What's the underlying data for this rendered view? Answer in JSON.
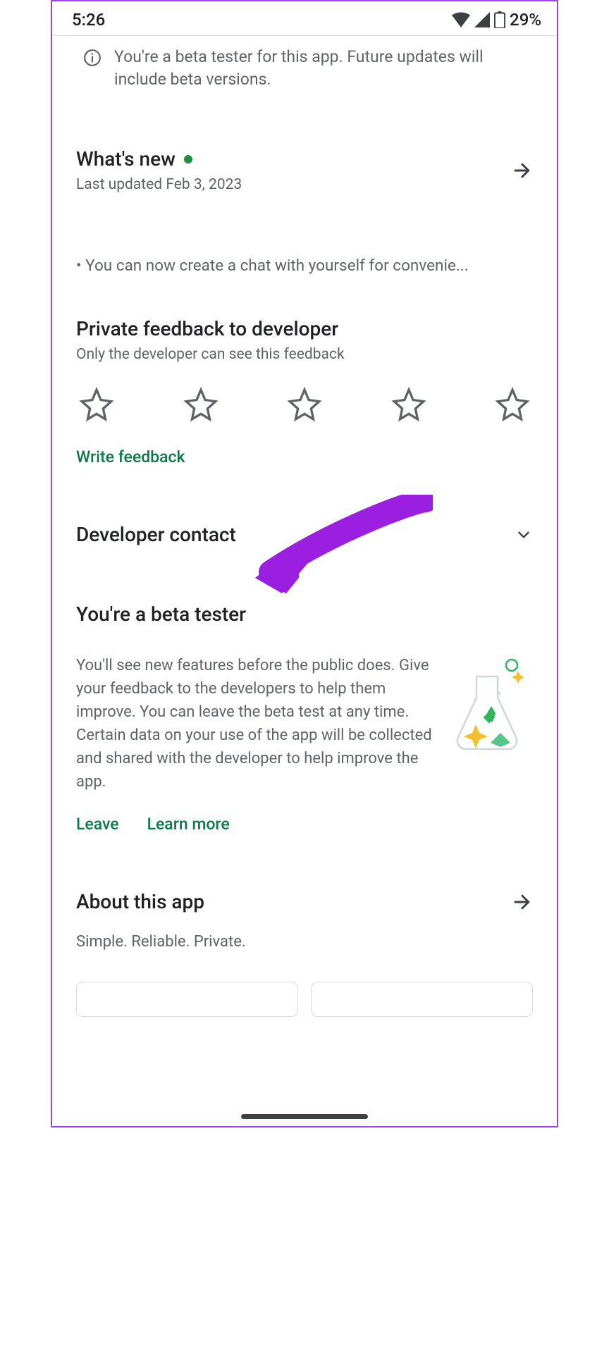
{
  "status": {
    "time": "5:26",
    "battery_pct": "29%"
  },
  "banner": {
    "text": "You're a beta tester for this app. Future updates will include beta versions."
  },
  "whats_new": {
    "title": "What's new",
    "updated": "Last updated Feb 3, 2023",
    "changelog": "• You can now create a chat with yourself for convenie..."
  },
  "feedback": {
    "title": "Private feedback to developer",
    "sub": "Only the developer can see this feedback",
    "write": "Write feedback"
  },
  "dev_contact": {
    "title": "Developer contact"
  },
  "beta": {
    "title": "You're a beta tester",
    "body": "You'll see new features before the public does. Give your feedback to the developers to help them improve. You can leave the beta test at any time. Certain data on your use of the app will be collected and shared with the developer to help improve the app.",
    "leave": "Leave",
    "learn": "Learn more"
  },
  "about": {
    "title": "About this app",
    "desc": "Simple. Reliable. Private."
  }
}
